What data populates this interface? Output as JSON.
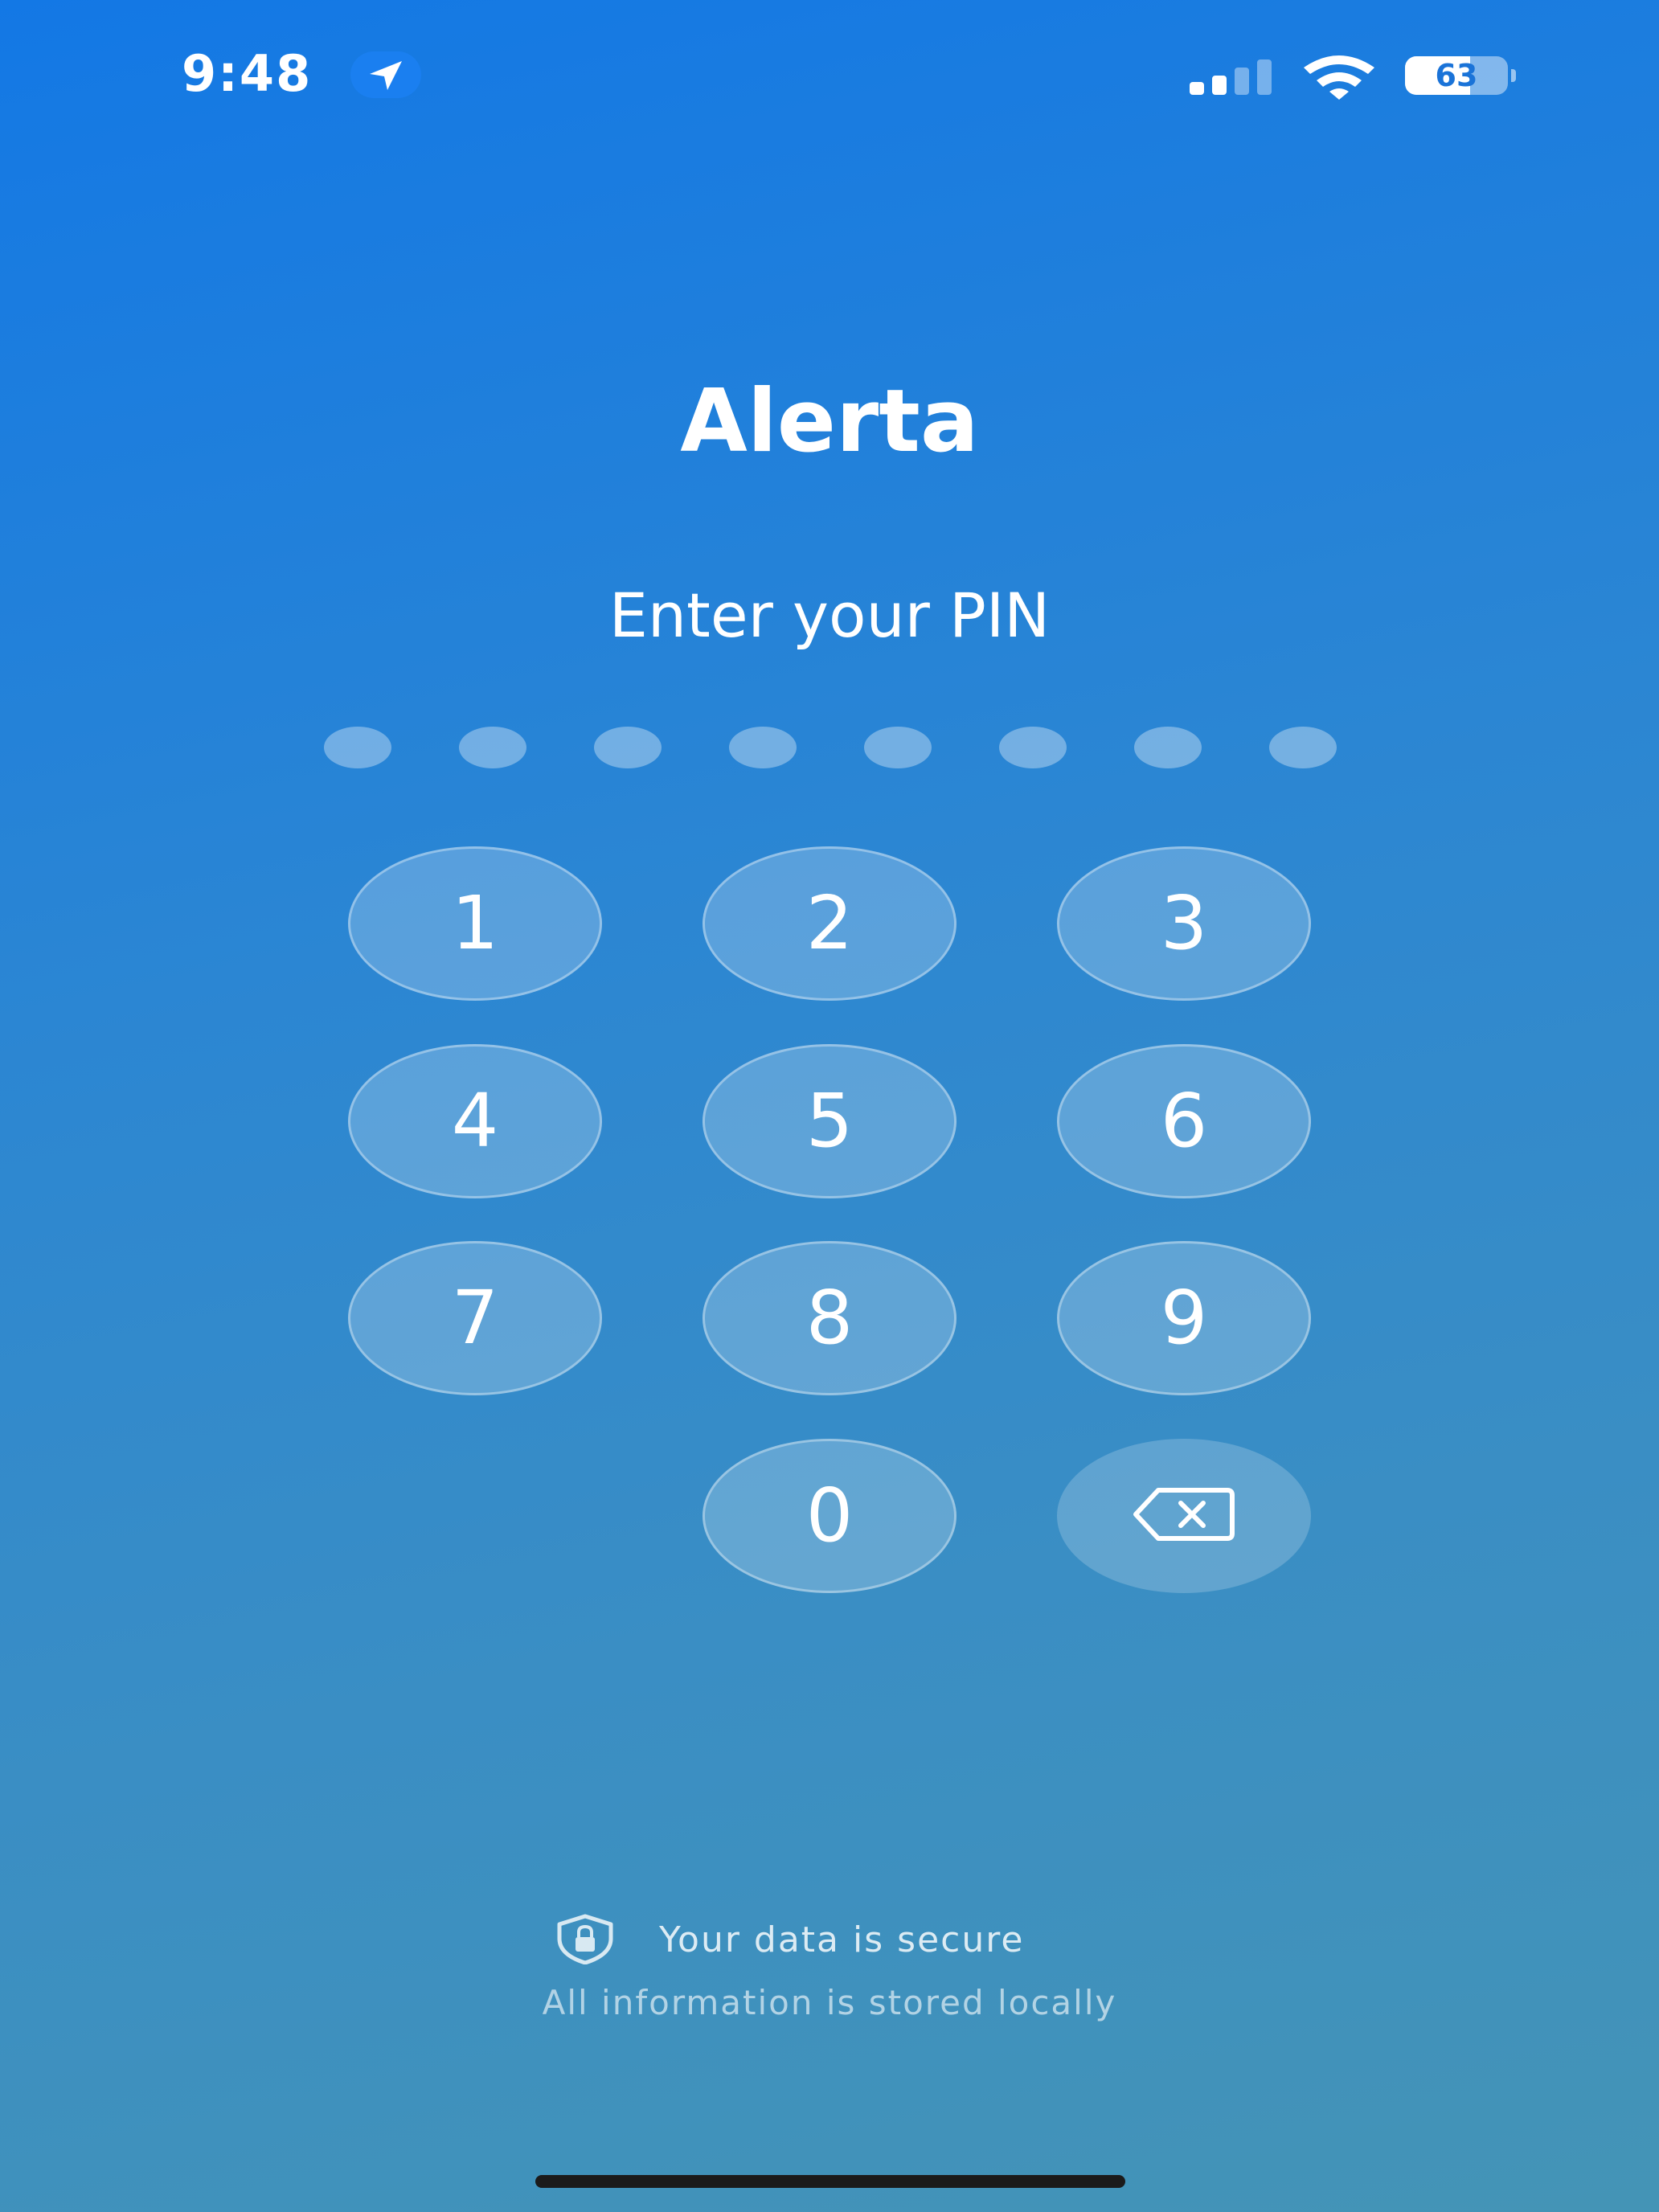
{
  "status_bar": {
    "time": "9:48",
    "battery_level": "63",
    "battery_fraction": 0.63,
    "signal_bars_active": 2,
    "signal_bars_total": 4,
    "icons": [
      "location-arrow-icon",
      "cellular-signal-icon",
      "wifi-icon",
      "battery-icon"
    ]
  },
  "app": {
    "title": "Alerta",
    "prompt": "Enter your PIN"
  },
  "pin": {
    "length": 8,
    "entered": 0
  },
  "keypad": {
    "keys": [
      "1",
      "2",
      "3",
      "4",
      "5",
      "6",
      "7",
      "8",
      "9",
      "0"
    ],
    "delete_icon": "backspace-icon"
  },
  "footer": {
    "secure_icon": "shield-lock-icon",
    "secure_text": "Your data is secure",
    "local_text": "All information is stored locally"
  },
  "colors": {
    "gradient_top": "#1378e5",
    "gradient_bottom": "#4494b6",
    "text": "#ffffff"
  }
}
